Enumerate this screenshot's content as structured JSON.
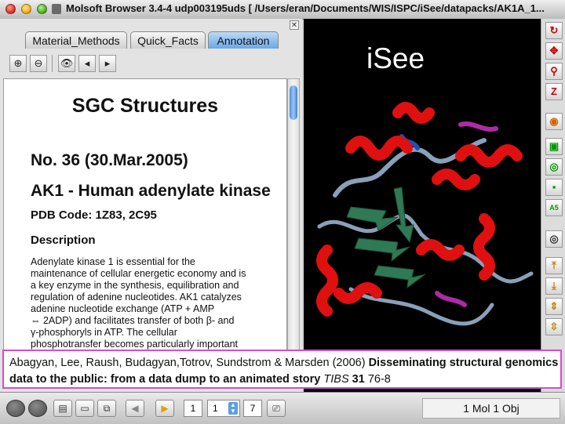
{
  "window": {
    "title": "Molsoft Browser 3.4-4 udp003195uds [ /Users/eran/Documents/WIS/ISPC/iSee/datapacks/AK1A_1..."
  },
  "tabs": [
    {
      "label": "Material_Methods"
    },
    {
      "label": "Quick_Facts"
    },
    {
      "label": "Annotation"
    }
  ],
  "document": {
    "heading": "SGC Structures",
    "number": "No. 36 (30.Mar.2005)",
    "protein": "AK1 - Human adenylate kinase",
    "pdb": "PDB Code: 1Z83, 2C95",
    "description_heading": "Description",
    "body_lines": [
      "Adenylate kinase 1 is essential for the",
      "maintenance of cellular energetic economy and is",
      "a key enzyme in the synthesis, equilibration and",
      "regulation of adenine nucleotides. AK1 catalyzes",
      "adenine nucleotide exchange (ATP  +  AMP",
      "⇔   2ADP) and facilitates transfer of both β- and",
      "γ-phosphoryls in ATP. The cellular",
      "phosphotransfer becomes particularly important"
    ]
  },
  "viewer": {
    "overlay_title": "iSee"
  },
  "citation": {
    "authors": "Abagyan, Lee, Raush, Budagyan,Totrov, Sundstrom & Marsden (2006) ",
    "title": "Disseminating structural genomics data to the public: from a data dump to an animated story",
    "journal": "TIBS",
    "volume": "31",
    "pages": " 76-8"
  },
  "statusbar": {
    "slide_first": "1",
    "slide_current": "1",
    "slide_last": "7",
    "status": "1 Mol 1 Obj"
  },
  "colors": {
    "active_tab": "#6aa7e6",
    "citation_border": "#d64ad6",
    "helix": "#e01010",
    "strand": "#2f7a55",
    "coil": "#8aa0b8"
  }
}
